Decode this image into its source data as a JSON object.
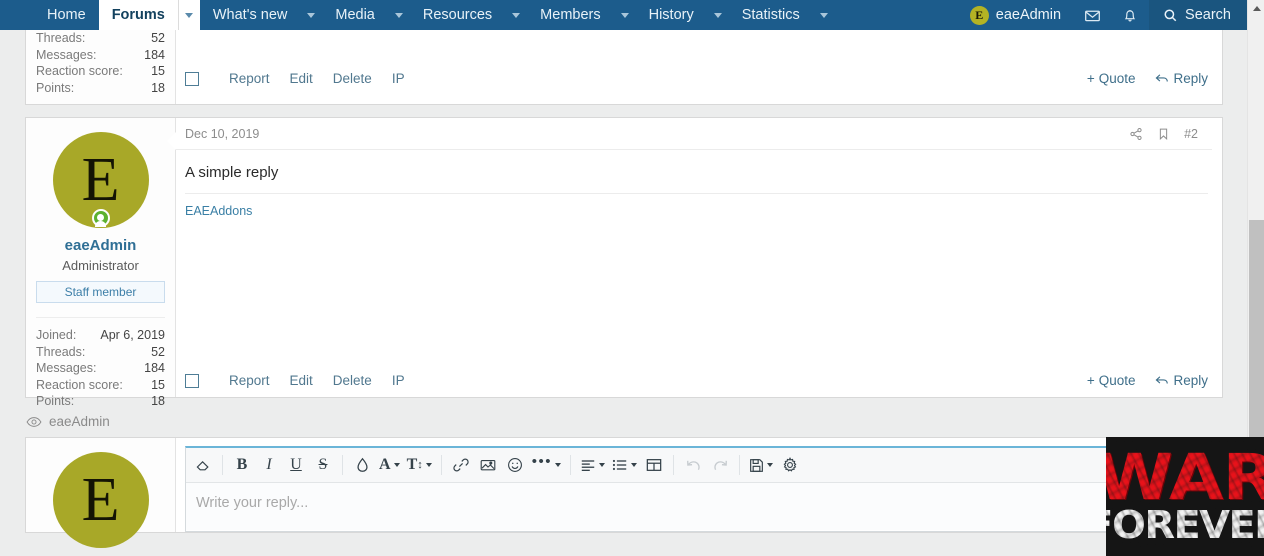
{
  "nav": {
    "items": [
      {
        "label": "Home",
        "has_caret": false,
        "active": false
      },
      {
        "label": "Forums",
        "has_caret": true,
        "active": true
      },
      {
        "label": "What's new",
        "has_caret": true,
        "active": false
      },
      {
        "label": "Media",
        "has_caret": true,
        "active": false
      },
      {
        "label": "Resources",
        "has_caret": true,
        "active": false
      },
      {
        "label": "Members",
        "has_caret": true,
        "active": false
      },
      {
        "label": "History",
        "has_caret": true,
        "active": false
      },
      {
        "label": "Statistics",
        "has_caret": true,
        "active": false
      }
    ],
    "user": {
      "name": "eaeAdmin",
      "avatar_letter": "E"
    },
    "inbox_icon": "envelope-icon",
    "alerts_icon": "bell-icon",
    "search_label": "Search",
    "search_icon": "search-icon"
  },
  "colors": {
    "navbar_bg": "#1c5c8c",
    "link": "#51788f",
    "username": "#2f6f95",
    "avatar_bg": "#a8a828",
    "online": "#5cb130",
    "editor_accent": "#6bb5d8",
    "banner_red": "#e8121a"
  },
  "post_top": {
    "stats": [
      {
        "label": "Threads:",
        "value": "52"
      },
      {
        "label": "Messages:",
        "value": "184"
      },
      {
        "label": "Reaction score:",
        "value": "15"
      },
      {
        "label": "Points:",
        "value": "18"
      }
    ],
    "footer_links": [
      "Report",
      "Edit",
      "Delete",
      "IP"
    ],
    "quote_label": "Quote",
    "reply_label": "Reply"
  },
  "post": {
    "user": {
      "avatar_letter": "E",
      "name": "eaeAdmin",
      "title": "Administrator",
      "badge": "Staff member"
    },
    "stats": [
      {
        "label": "Joined:",
        "value": "Apr 6, 2019"
      },
      {
        "label": "Threads:",
        "value": "52"
      },
      {
        "label": "Messages:",
        "value": "184"
      },
      {
        "label": "Reaction score:",
        "value": "15"
      },
      {
        "label": "Points:",
        "value": "18"
      }
    ],
    "date": "Dec 10, 2019",
    "share_icon": "share-icon",
    "bookmark_icon": "bookmark-icon",
    "number": "#2",
    "body": "A simple reply",
    "signature": "EAEAddons",
    "footer_links": [
      "Report",
      "Edit",
      "Delete",
      "IP"
    ],
    "quote_label": "Quote",
    "reply_label": "Reply"
  },
  "viewing": {
    "eye_icon": "eye-icon",
    "name": "eaeAdmin"
  },
  "reply_editor": {
    "avatar_letter": "E",
    "placeholder": "Write your reply...",
    "toolbar": [
      {
        "name": "remove-formatting-icon",
        "glyph": "◇",
        "caret": false,
        "disabled": false
      },
      {
        "name": "bold-icon",
        "glyph": "B",
        "caret": false,
        "disabled": false
      },
      {
        "name": "italic-icon",
        "glyph": "I",
        "caret": false,
        "disabled": false
      },
      {
        "name": "underline-icon",
        "glyph": "U",
        "caret": false,
        "disabled": false
      },
      {
        "name": "strikethrough-icon",
        "glyph": "S",
        "caret": false,
        "disabled": false
      },
      {
        "name": "text-color-icon",
        "glyph": "◆",
        "caret": false,
        "disabled": false
      },
      {
        "name": "font-family-icon",
        "glyph": "A",
        "caret": true,
        "disabled": false
      },
      {
        "name": "font-size-icon",
        "glyph": "T",
        "caret": true,
        "disabled": false
      },
      {
        "name": "link-icon",
        "glyph": "🔗",
        "caret": false,
        "disabled": false
      },
      {
        "name": "image-icon",
        "glyph": "Ὓc",
        "caret": false,
        "disabled": false
      },
      {
        "name": "emoji-icon",
        "glyph": "☺",
        "caret": false,
        "disabled": false
      },
      {
        "name": "more-options-icon",
        "glyph": "⋯",
        "caret": true,
        "disabled": false
      },
      {
        "name": "align-icon",
        "glyph": "≡",
        "caret": true,
        "disabled": false
      },
      {
        "name": "list-icon",
        "glyph": "☰",
        "caret": true,
        "disabled": false
      },
      {
        "name": "table-icon",
        "glyph": "⊞",
        "caret": false,
        "disabled": false
      },
      {
        "name": "undo-icon",
        "glyph": "↶",
        "caret": false,
        "disabled": true
      },
      {
        "name": "redo-icon",
        "glyph": "↷",
        "caret": false,
        "disabled": true
      },
      {
        "name": "draft-icon",
        "glyph": "💾",
        "caret": true,
        "disabled": false
      },
      {
        "name": "settings-gear-icon",
        "glyph": "⚙",
        "caret": false,
        "disabled": false
      }
    ]
  },
  "banner": {
    "line1": "WAR",
    "line2": "FOREVER"
  }
}
